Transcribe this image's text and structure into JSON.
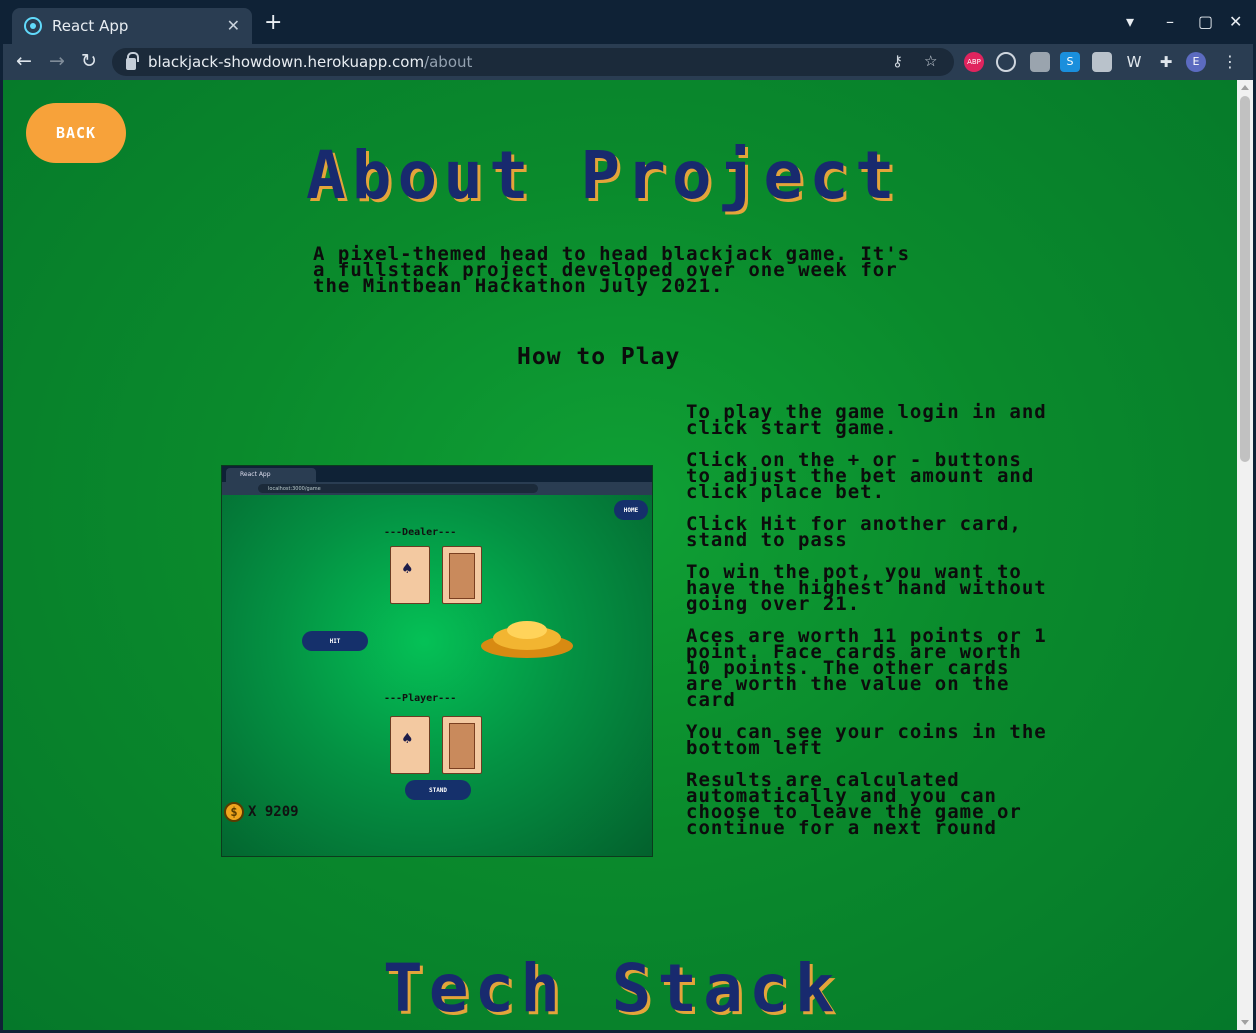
{
  "browser": {
    "tab_title": "React App",
    "url_host": "blackjack-showdown.herokuapp.com",
    "url_path": "/about"
  },
  "page": {
    "back_label": "BACK",
    "title": "About Project",
    "intro": "A pixel-themed head to head blackjack game. It's a fullstack project developed over one week for the Mintbean Hackathon July 2021.",
    "how_to_play": "How to Play",
    "steps": [
      "To play the game login in and click start game.",
      "Click on the + or - buttons to adjust the bet amount and click place bet.",
      "Click Hit for another card, stand to pass",
      "To win the pot, you want to have the highest hand without going over 21.",
      "Aces are worth 11 points or 1 point. Face cards are worth 10 points. The other cards are worth the value on the card",
      "You can see your coins in the bottom left",
      "Results are calculated automatically and you can choose to leave the game or continue for a next round"
    ],
    "tech_title": "Tech Stack"
  },
  "screenshot": {
    "tab_title": "React App",
    "url": "localhost:3000/game",
    "home_label": "HOME",
    "dealer_label": "---Dealer---",
    "player_label": "---Player---",
    "hit_label": "HIT",
    "stand_label": "STAND",
    "coin_symbol": "$",
    "coin_text": "X 9209"
  },
  "colors": {
    "page_bg": "#0a8a2c",
    "title": "#182a6e",
    "title_shadow": "#e3a43a",
    "back_button": "#f7a23a"
  }
}
